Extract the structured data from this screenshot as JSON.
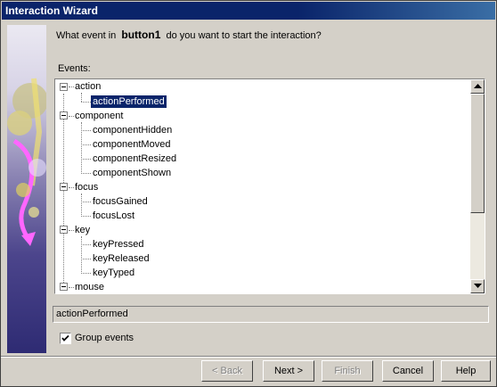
{
  "window": {
    "title": "Interaction Wizard"
  },
  "prompt": {
    "prefix": "What event in",
    "component": "button1",
    "suffix": "do you want to start the interaction?"
  },
  "events_label": "Events:",
  "tree": {
    "groups": [
      {
        "label": "action",
        "children": [
          "actionPerformed"
        ]
      },
      {
        "label": "component",
        "children": [
          "componentHidden",
          "componentMoved",
          "componentResized",
          "componentShown"
        ]
      },
      {
        "label": "focus",
        "children": [
          "focusGained",
          "focusLost"
        ]
      },
      {
        "label": "key",
        "children": [
          "keyPressed",
          "keyReleased",
          "keyTyped"
        ]
      },
      {
        "label": "mouse",
        "children": []
      }
    ],
    "selected": "actionPerformed"
  },
  "selected_event": "actionPerformed",
  "group_events": {
    "label": "Group events",
    "checked": true
  },
  "buttons": {
    "back": "< Back",
    "next": "Next >",
    "finish": "Finish",
    "cancel": "Cancel",
    "help": "Help"
  },
  "icons": {
    "checkmark": "checkmark-icon",
    "scroll_up": "arrow-up-icon",
    "scroll_down": "arrow-down-icon",
    "expander": "minus-box-icon",
    "wizard_art": "wizard-graphic"
  }
}
